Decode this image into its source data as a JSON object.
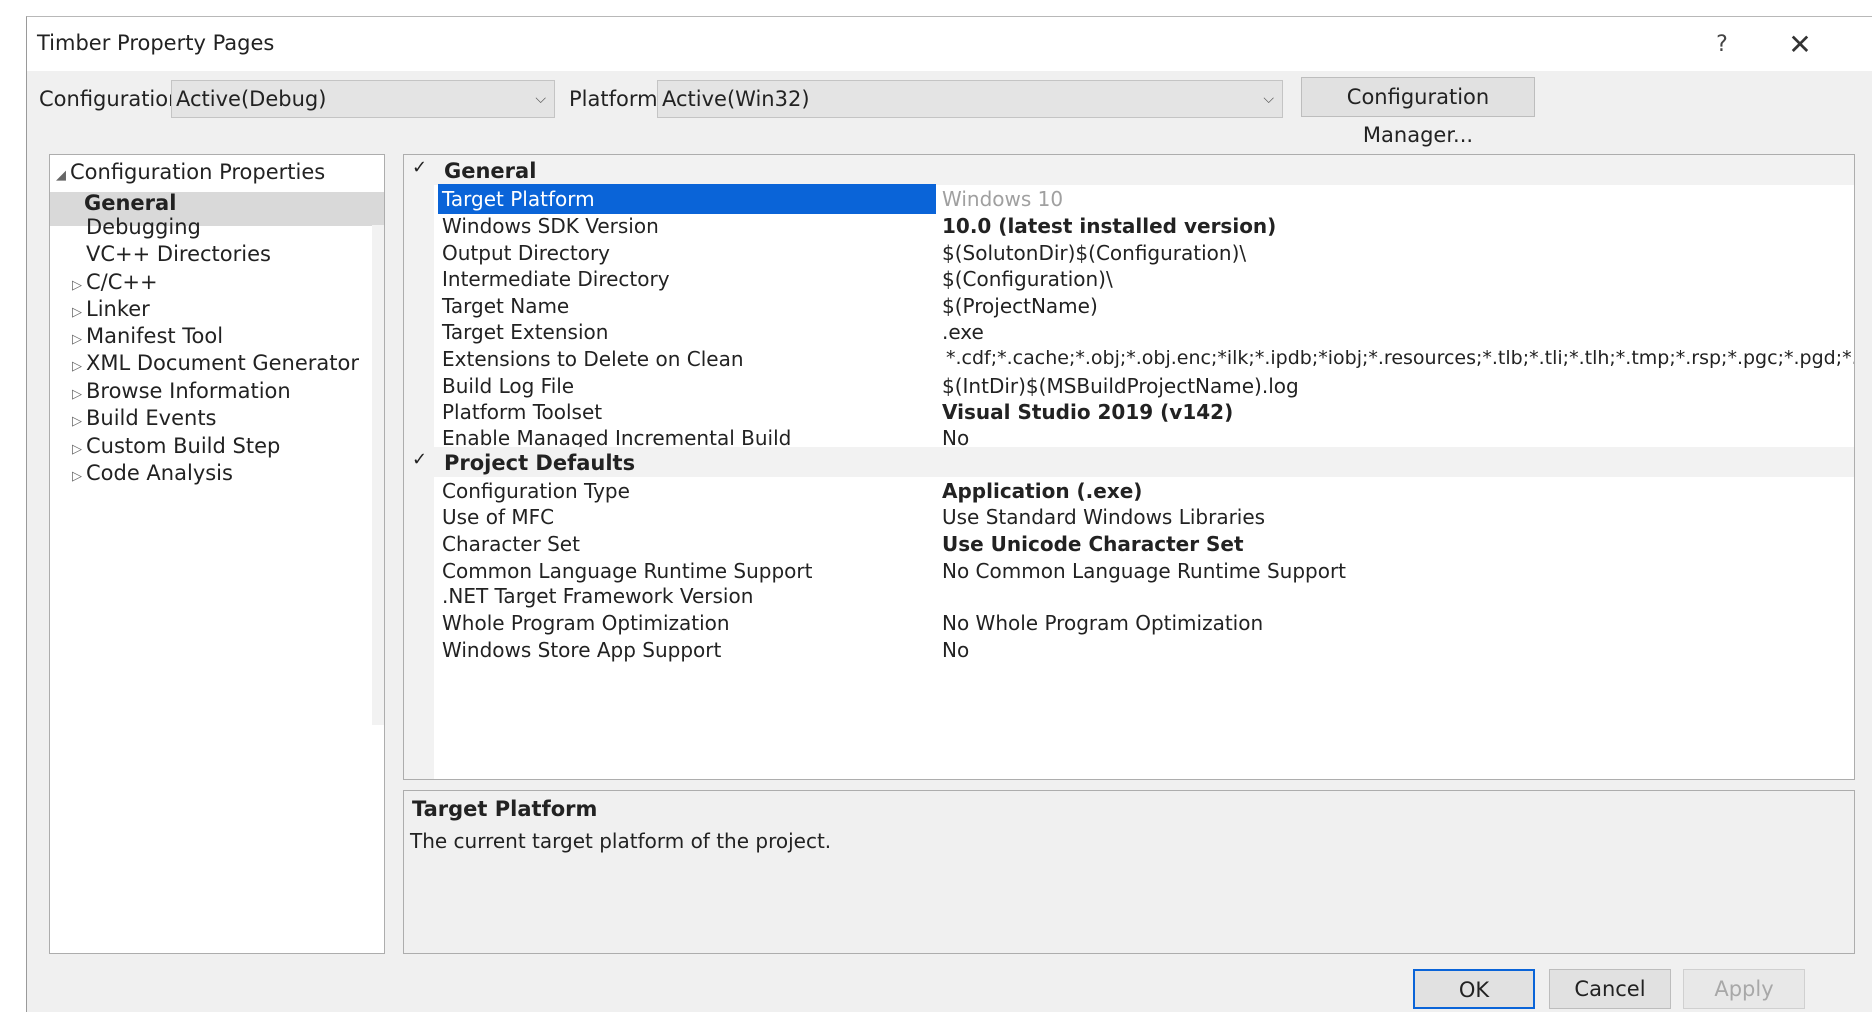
{
  "window": {
    "title": "Timber Property Pages",
    "help_glyph": "?",
    "close_glyph": "✕"
  },
  "toolbar": {
    "configuration_label": "Configuration:",
    "configuration_value": "Active(Debug)",
    "platform_label": "Platform:",
    "platform_value": "Active(Win32)",
    "config_manager_label": "Configuration Manager..."
  },
  "tree": {
    "root": "Configuration Properties",
    "items": [
      {
        "label": "General",
        "expandable": false,
        "selected": true
      },
      {
        "label": "Debugging",
        "expandable": false
      },
      {
        "label": "VC++ Directories",
        "expandable": false
      },
      {
        "label": "C/C++",
        "expandable": true
      },
      {
        "label": "Linker",
        "expandable": true
      },
      {
        "label": "Manifest Tool",
        "expandable": true
      },
      {
        "label": "XML Document Generator",
        "expandable": true
      },
      {
        "label": "Browse Information",
        "expandable": true
      },
      {
        "label": "Build Events",
        "expandable": true
      },
      {
        "label": "Custom Build Step",
        "expandable": true
      },
      {
        "label": "Code Analysis",
        "expandable": true
      }
    ]
  },
  "grid": {
    "categories": [
      {
        "label": "General",
        "properties": [
          {
            "name": "Target Platform",
            "value": "Windows 10",
            "style": "gray",
            "selected": true
          },
          {
            "name": "Windows SDK Version",
            "value": "10.0 (latest installed version)",
            "style": "bold"
          },
          {
            "name": "Output Directory",
            "value": "$(SolutonDir)$(Configuration)\\",
            "style": ""
          },
          {
            "name": "Intermediate Directory",
            "value": "$(Configuration)\\",
            "style": ""
          },
          {
            "name": "Target Name",
            "value": "$(ProjectName)",
            "style": ""
          },
          {
            "name": "Target Extension",
            "value": ".exe",
            "style": ""
          },
          {
            "name": "Extensions to Delete on Clean",
            "value": "*.cdf;*.cache;*.obj;*.obj.enc;*ilk;*.ipdb;*iobj;*.resources;*.tlb;*.tli;*.tlh;*.tmp;*.rsp;*.pgc;*.pgd;*.m",
            "style": ""
          },
          {
            "name": "Build Log File",
            "value": "$(IntDir)$(MSBuildProjectName).log",
            "style": ""
          },
          {
            "name": "Platform Toolset",
            "value": "Visual Studio 2019 (v142)",
            "style": "bold"
          },
          {
            "name": "Enable Managed Incremental Build",
            "value": "No",
            "style": ""
          }
        ]
      },
      {
        "label": "Project Defaults",
        "properties": [
          {
            "name": "Configuration Type",
            "value": "Application (.exe)",
            "style": "bold"
          },
          {
            "name": "Use of MFC",
            "value": "Use Standard Windows Libraries",
            "style": ""
          },
          {
            "name": "Character Set",
            "value": "Use Unicode Character Set",
            "style": "bold"
          },
          {
            "name": "Common Language Runtime Support",
            "value": "No Common Language Runtime Support",
            "style": ""
          },
          {
            "name": ".NET Target Framework Version",
            "value": "",
            "style": ""
          },
          {
            "name": "Whole Program Optimization",
            "value": "No Whole Program Optimization",
            "style": ""
          },
          {
            "name": "Windows Store App Support",
            "value": "No",
            "style": ""
          }
        ]
      }
    ]
  },
  "description": {
    "title": "Target Platform",
    "text": "The current target platform of the project."
  },
  "buttons": {
    "ok": "OK",
    "cancel": "Cancel",
    "apply": "Apply"
  },
  "colors": {
    "selection": "#0a64d8",
    "tree_selection": "#d9d9d9",
    "disabled_text": "#a0a0a0"
  }
}
